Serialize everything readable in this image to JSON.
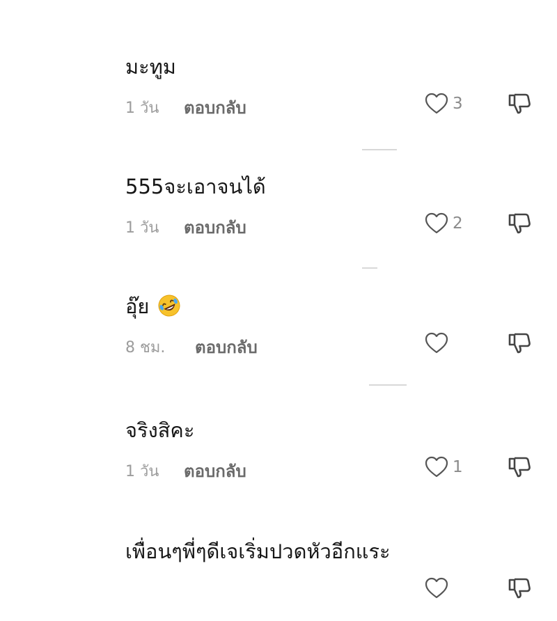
{
  "reply_label": "ตอบกลับ",
  "comments": [
    {
      "text": "มะทูม",
      "time": "1 วัน",
      "likes": "3"
    },
    {
      "text": "555จะเอาจนได้",
      "time": "1 วัน",
      "likes": "2"
    },
    {
      "text": "อุ๊ย",
      "emoji": "rolling-on-floor-laughing",
      "time": "8 ชม.",
      "likes": ""
    },
    {
      "text": "จริงสิคะ",
      "time": "1 วัน",
      "likes": "1"
    },
    {
      "text": "เพื่อนๆพี่ๆดีเจเริ่มปวดหัวอีกแระ",
      "time": "",
      "likes": ""
    }
  ],
  "icons": {
    "like": "heart-outline-icon",
    "dislike": "thumbs-down-icon"
  },
  "colors": {
    "text": "#161616",
    "meta": "#9c9c9c",
    "reply": "#6a6a6a",
    "icon": "#555555"
  }
}
